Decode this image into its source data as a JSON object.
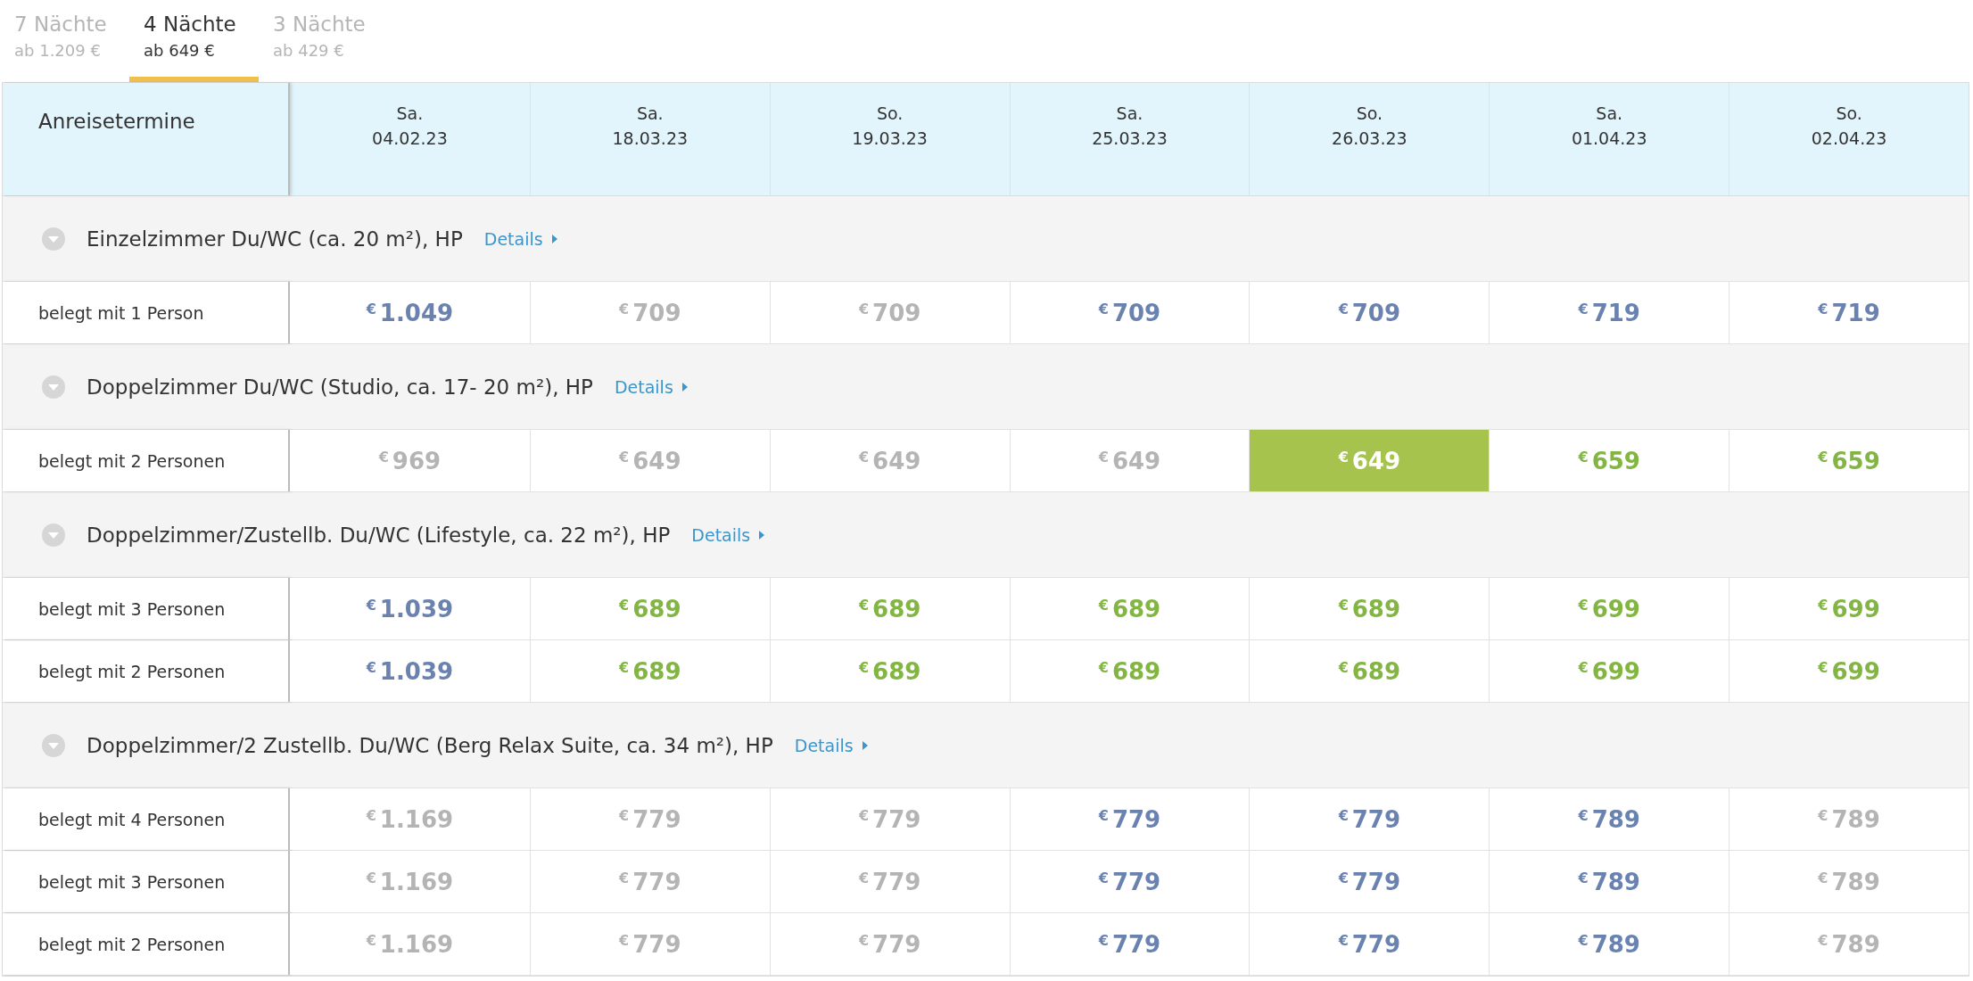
{
  "tabs": [
    {
      "label": "7 Nächte",
      "price": "ab 1.209 €",
      "selected": false
    },
    {
      "label": "4 Nächte",
      "price": "ab 649 €",
      "selected": true
    },
    {
      "label": "3 Nächte",
      "price": "ab 429 €",
      "selected": false
    }
  ],
  "table": {
    "corner_label": "Anreisetermine",
    "columns": [
      {
        "day": "Sa.",
        "date": "04.02.23"
      },
      {
        "day": "Sa.",
        "date": "18.03.23"
      },
      {
        "day": "So.",
        "date": "19.03.23"
      },
      {
        "day": "Sa.",
        "date": "25.03.23"
      },
      {
        "day": "So.",
        "date": "26.03.23"
      },
      {
        "day": "Sa.",
        "date": "01.04.23"
      },
      {
        "day": "So.",
        "date": "02.04.23"
      }
    ],
    "groups": [
      {
        "title": "Einzelzimmer Du/WC (ca. 20 m²), HP",
        "details_link": "Details",
        "expanded": true,
        "rows": [
          {
            "label": "belegt mit 1 Person",
            "cells": [
              {
                "currency": "€",
                "amount": "1.049",
                "kind": "standard",
                "selected": false
              },
              {
                "currency": "€",
                "amount": "709",
                "kind": "unavailable",
                "selected": false
              },
              {
                "currency": "€",
                "amount": "709",
                "kind": "unavailable",
                "selected": false
              },
              {
                "currency": "€",
                "amount": "709",
                "kind": "standard",
                "selected": false
              },
              {
                "currency": "€",
                "amount": "709",
                "kind": "standard",
                "selected": false
              },
              {
                "currency": "€",
                "amount": "719",
                "kind": "standard",
                "selected": false
              },
              {
                "currency": "€",
                "amount": "719",
                "kind": "standard",
                "selected": false
              }
            ]
          }
        ]
      },
      {
        "title": "Doppelzimmer Du/WC (Studio, ca. 17- 20 m²), HP",
        "details_link": "Details",
        "expanded": true,
        "rows": [
          {
            "label": "belegt mit 2 Personen",
            "cells": [
              {
                "currency": "€",
                "amount": "969",
                "kind": "unavailable",
                "selected": false
              },
              {
                "currency": "€",
                "amount": "649",
                "kind": "unavailable",
                "selected": false
              },
              {
                "currency": "€",
                "amount": "649",
                "kind": "unavailable",
                "selected": false
              },
              {
                "currency": "€",
                "amount": "649",
                "kind": "unavailable",
                "selected": false
              },
              {
                "currency": "€",
                "amount": "649",
                "kind": "best",
                "selected": true
              },
              {
                "currency": "€",
                "amount": "659",
                "kind": "best",
                "selected": false
              },
              {
                "currency": "€",
                "amount": "659",
                "kind": "best",
                "selected": false
              }
            ]
          }
        ]
      },
      {
        "title": "Doppelzimmer/Zustellb. Du/WC (Lifestyle, ca. 22 m²), HP",
        "details_link": "Details",
        "expanded": true,
        "rows": [
          {
            "label": "belegt mit 3 Personen",
            "cells": [
              {
                "currency": "€",
                "amount": "1.039",
                "kind": "standard",
                "selected": false
              },
              {
                "currency": "€",
                "amount": "689",
                "kind": "best",
                "selected": false
              },
              {
                "currency": "€",
                "amount": "689",
                "kind": "best",
                "selected": false
              },
              {
                "currency": "€",
                "amount": "689",
                "kind": "best",
                "selected": false
              },
              {
                "currency": "€",
                "amount": "689",
                "kind": "best",
                "selected": false
              },
              {
                "currency": "€",
                "amount": "699",
                "kind": "best",
                "selected": false
              },
              {
                "currency": "€",
                "amount": "699",
                "kind": "best",
                "selected": false
              }
            ]
          },
          {
            "label": "belegt mit 2 Personen",
            "cells": [
              {
                "currency": "€",
                "amount": "1.039",
                "kind": "standard",
                "selected": false
              },
              {
                "currency": "€",
                "amount": "689",
                "kind": "best",
                "selected": false
              },
              {
                "currency": "€",
                "amount": "689",
                "kind": "best",
                "selected": false
              },
              {
                "currency": "€",
                "amount": "689",
                "kind": "best",
                "selected": false
              },
              {
                "currency": "€",
                "amount": "689",
                "kind": "best",
                "selected": false
              },
              {
                "currency": "€",
                "amount": "699",
                "kind": "best",
                "selected": false
              },
              {
                "currency": "€",
                "amount": "699",
                "kind": "best",
                "selected": false
              }
            ]
          }
        ]
      },
      {
        "title": "Doppelzimmer/2 Zustellb. Du/WC (Berg Relax Suite, ca. 34 m²), HP",
        "details_link": "Details",
        "expanded": true,
        "rows": [
          {
            "label": "belegt mit 4 Personen",
            "cells": [
              {
                "currency": "€",
                "amount": "1.169",
                "kind": "unavailable",
                "selected": false
              },
              {
                "currency": "€",
                "amount": "779",
                "kind": "unavailable",
                "selected": false
              },
              {
                "currency": "€",
                "amount": "779",
                "kind": "unavailable",
                "selected": false
              },
              {
                "currency": "€",
                "amount": "779",
                "kind": "standard",
                "selected": false
              },
              {
                "currency": "€",
                "amount": "779",
                "kind": "standard",
                "selected": false
              },
              {
                "currency": "€",
                "amount": "789",
                "kind": "standard",
                "selected": false
              },
              {
                "currency": "€",
                "amount": "789",
                "kind": "unavailable",
                "selected": false
              }
            ]
          },
          {
            "label": "belegt mit 3 Personen",
            "cells": [
              {
                "currency": "€",
                "amount": "1.169",
                "kind": "unavailable",
                "selected": false
              },
              {
                "currency": "€",
                "amount": "779",
                "kind": "unavailable",
                "selected": false
              },
              {
                "currency": "€",
                "amount": "779",
                "kind": "unavailable",
                "selected": false
              },
              {
                "currency": "€",
                "amount": "779",
                "kind": "standard",
                "selected": false
              },
              {
                "currency": "€",
                "amount": "779",
                "kind": "standard",
                "selected": false
              },
              {
                "currency": "€",
                "amount": "789",
                "kind": "standard",
                "selected": false
              },
              {
                "currency": "€",
                "amount": "789",
                "kind": "unavailable",
                "selected": false
              }
            ]
          },
          {
            "label": "belegt mit 2 Personen",
            "cells": [
              {
                "currency": "€",
                "amount": "1.169",
                "kind": "unavailable",
                "selected": false
              },
              {
                "currency": "€",
                "amount": "779",
                "kind": "unavailable",
                "selected": false
              },
              {
                "currency": "€",
                "amount": "779",
                "kind": "unavailable",
                "selected": false
              },
              {
                "currency": "€",
                "amount": "779",
                "kind": "standard",
                "selected": false
              },
              {
                "currency": "€",
                "amount": "779",
                "kind": "standard",
                "selected": false
              },
              {
                "currency": "€",
                "amount": "789",
                "kind": "standard",
                "selected": false
              },
              {
                "currency": "€",
                "amount": "789",
                "kind": "unavailable",
                "selected": false
              }
            ]
          }
        ]
      }
    ]
  }
}
